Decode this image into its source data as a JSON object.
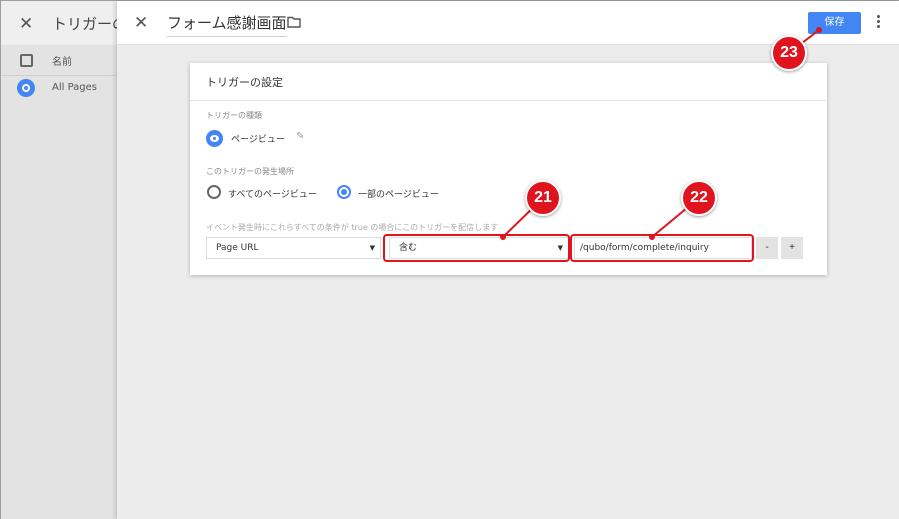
{
  "background": {
    "title": "トリガーの",
    "column_name": "名前",
    "rows": [
      {
        "label": "All Pages"
      }
    ]
  },
  "sheet": {
    "title": "フォーム感謝画面",
    "save_label": "保存"
  },
  "card": {
    "title": "トリガーの設定",
    "type_label": "トリガーの種類",
    "type_value": "ページビュー",
    "where_label": "このトリガーの発生場所",
    "option_all": "すべてのページビュー",
    "option_some": "一部のページビュー",
    "selected_option": "一部のページビュー",
    "condition_label": "イベント発生時にこれらすべての条件が true の場合にこのトリガーを配信します",
    "variable_select": "Page URL",
    "operator_select": "含む",
    "value_input": "/qubo/form/complete/inquiry",
    "minus_label": "-",
    "plus_label": "+"
  },
  "annotations": {
    "badge_21": "21",
    "badge_22": "22",
    "badge_23": "23",
    "color": "#e0141e"
  },
  "colors": {
    "accent": "#4285f4"
  },
  "icons": [
    "close-icon",
    "folder-icon",
    "more-vert-icon",
    "eye-icon",
    "pencil-icon",
    "checkbox-icon",
    "caret-down-icon"
  ]
}
